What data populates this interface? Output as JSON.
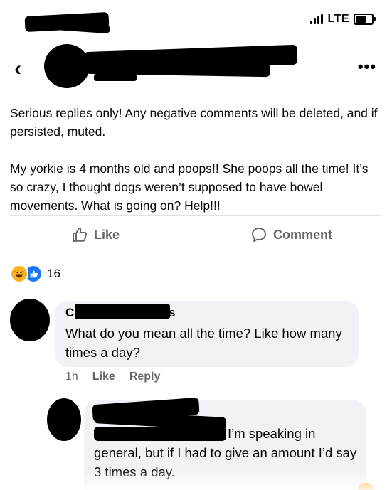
{
  "status_bar": {
    "network": "LTE"
  },
  "header": {
    "back_glyph": "‹",
    "more_glyph": "•••"
  },
  "post": {
    "paragraph_1": "Serious replies only! Any negative comments will be deleted, and if persisted, muted.",
    "paragraph_2": "My yorkie is 4 months old and poops!! She poops all the time! It’s so crazy, I thought dogs weren’t supposed to have bowel movements. What is going on? Help!!!"
  },
  "actions": {
    "like_label": "Like",
    "comment_label": "Comment"
  },
  "reactions": {
    "count": "16",
    "types": [
      "haha",
      "like"
    ]
  },
  "comments": [
    {
      "name_initial": "C",
      "name_tail": "s",
      "text": "What do you mean all the time? Like how many times a day?",
      "time": "1h",
      "like_label": "Like",
      "reply_label": "Reply"
    },
    {
      "text_line_1": "I’m speaking in",
      "text_rest": "general, but if I had to give an amount I’d say 3 times a day."
    }
  ],
  "colors": {
    "text": "#050505",
    "secondary_text": "#65676b",
    "bubble": "#f0f2f5",
    "like_blue": "#1877f2",
    "haha_yellow": "#f7b125"
  }
}
